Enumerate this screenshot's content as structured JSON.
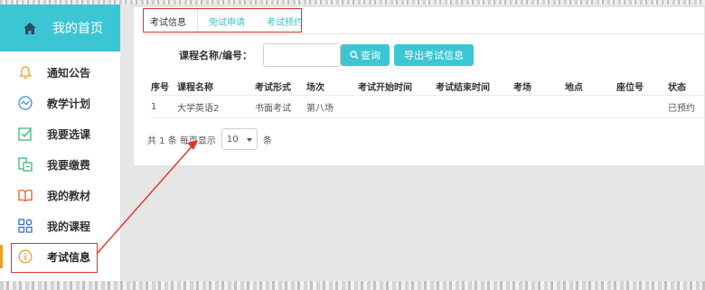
{
  "sidebar": {
    "home_label": "我的首页",
    "items": [
      {
        "label": "通知公告",
        "icon": "bell-icon"
      },
      {
        "label": "教学计划",
        "icon": "chart-icon"
      },
      {
        "label": "我要选课",
        "icon": "checklist-icon"
      },
      {
        "label": "我要缴费",
        "icon": "payment-icon"
      },
      {
        "label": "我的教材",
        "icon": "book-icon"
      },
      {
        "label": "我的课程",
        "icon": "grid-icon"
      },
      {
        "label": "考试信息",
        "icon": "info-icon"
      }
    ]
  },
  "tabs": [
    {
      "label": "考试信息"
    },
    {
      "label": "免试申请"
    },
    {
      "label": "考试预约"
    }
  ],
  "filter": {
    "course_label": "课程名称/编号：",
    "course_value": "",
    "query_button": "查询",
    "export_button": "导出考试信息"
  },
  "table": {
    "headers": [
      "序号",
      "课程名称",
      "考试形式",
      "场次",
      "考试开始时间",
      "考试结束时间",
      "考场",
      "地点",
      "座位号",
      "状态"
    ],
    "rows": [
      [
        "1",
        "大学英语2",
        "书面考试",
        "第八场",
        "",
        "",
        "",
        "",
        "",
        "已预约"
      ]
    ]
  },
  "pager": {
    "prefix": "共 1 条 每页显示",
    "page_size": "10",
    "suffix": "条"
  },
  "colors": {
    "accent": "#3cc6d3",
    "annotation": "#e0302c"
  }
}
